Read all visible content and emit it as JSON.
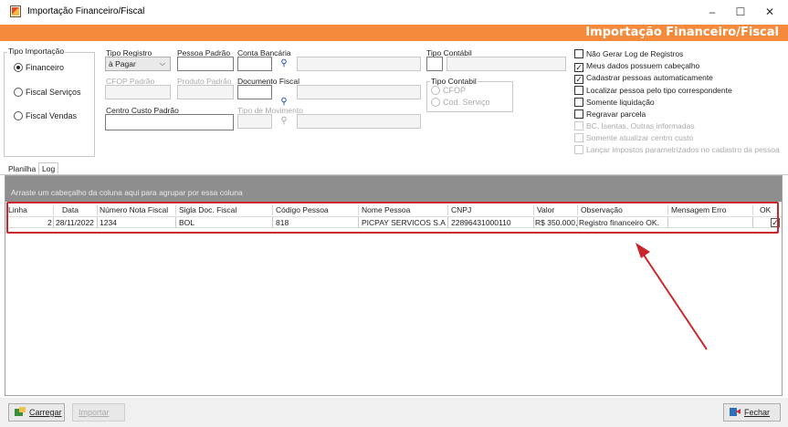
{
  "window": {
    "title": "Importação Financeiro/Fiscal",
    "minimize": "–",
    "maximize": "☐",
    "close": "✕"
  },
  "header": {
    "title": "Importação Financeiro/Fiscal"
  },
  "form": {
    "tipo_importacao": {
      "label": "Tipo Importação",
      "options": [
        "Financeiro",
        "Fiscal Serviços",
        "Fiscal Vendas"
      ],
      "selected": "Financeiro"
    },
    "tipo_registro": {
      "label": "Tipo Registro",
      "value": "à Pagar"
    },
    "pessoa_padrao": {
      "label": "Pessoa Padrão",
      "value": ""
    },
    "conta_bancaria": {
      "label": "Conta Bancária",
      "value": ""
    },
    "tipo_contabil": {
      "label": "Tipo Contábil",
      "value": ""
    },
    "cfop_padrao": {
      "label": "CFOP Padrão",
      "value": ""
    },
    "produto_padrao": {
      "label": "Produto Padrão",
      "value": ""
    },
    "documento_fiscal": {
      "label": "Documento Fiscal",
      "value": ""
    },
    "tipo_contabil_group": {
      "label": "Tipo Contabil",
      "options": [
        "CFOP",
        "Cod. Serviço"
      ]
    },
    "centro_custo_padrao": {
      "label": "Centro Custo Padrão",
      "value": ""
    },
    "tipo_movimento": {
      "label": "Tipo de Movimento",
      "value": ""
    }
  },
  "options": [
    {
      "label": "Não Gerar Log de Registros",
      "checked": false,
      "enabled": true
    },
    {
      "label": "Meus dados possuem cabeçalho",
      "checked": true,
      "enabled": true
    },
    {
      "label": "Cadastrar pessoas automaticamente",
      "checked": true,
      "enabled": true
    },
    {
      "label": "Localizar pessoa pelo tipo correspondente",
      "checked": false,
      "enabled": true
    },
    {
      "label": "Somente liquidação",
      "checked": false,
      "enabled": true
    },
    {
      "label": "Regravar parcela",
      "checked": false,
      "enabled": true
    },
    {
      "label": "BC, Isentas, Outras informadas",
      "checked": false,
      "enabled": false
    },
    {
      "label": "Somente atualizar centro custo",
      "checked": false,
      "enabled": false
    },
    {
      "label": "Lançar impostos parametrizados no cadastro da pessoa",
      "checked": false,
      "enabled": false
    }
  ],
  "tabs": [
    {
      "label": "Planilha",
      "active": false
    },
    {
      "label": "Log",
      "active": true
    }
  ],
  "grid": {
    "group_hint": "Arraste um cabeçalho da coluna aqui para agrupar por essa coluna",
    "columns": [
      "Linha",
      "Data",
      "Número Nota Fiscal",
      "Sigla Doc. Fiscal",
      "Código Pessoa",
      "Nome Pessoa",
      "CNPJ",
      "Valor",
      "Observação",
      "Mensagem Erro",
      "OK"
    ],
    "rows": [
      {
        "linha": "2",
        "data": "28/11/2022",
        "numero_nf": "1234",
        "sigla": "BOL",
        "codigo_pessoa": "818",
        "nome_pessoa": "PICPAY SERVICOS S.A",
        "cnpj": "22896431000110",
        "valor": "R$ 350.000,",
        "observacao": "Registro financeiro OK.",
        "mensagem_erro": "",
        "ok": true
      }
    ]
  },
  "buttons": {
    "carregar": "Carregar",
    "importar": "Importar",
    "fechar": "Fechar"
  },
  "colors": {
    "accent": "#f58a3c",
    "highlight": "#c9252b"
  }
}
